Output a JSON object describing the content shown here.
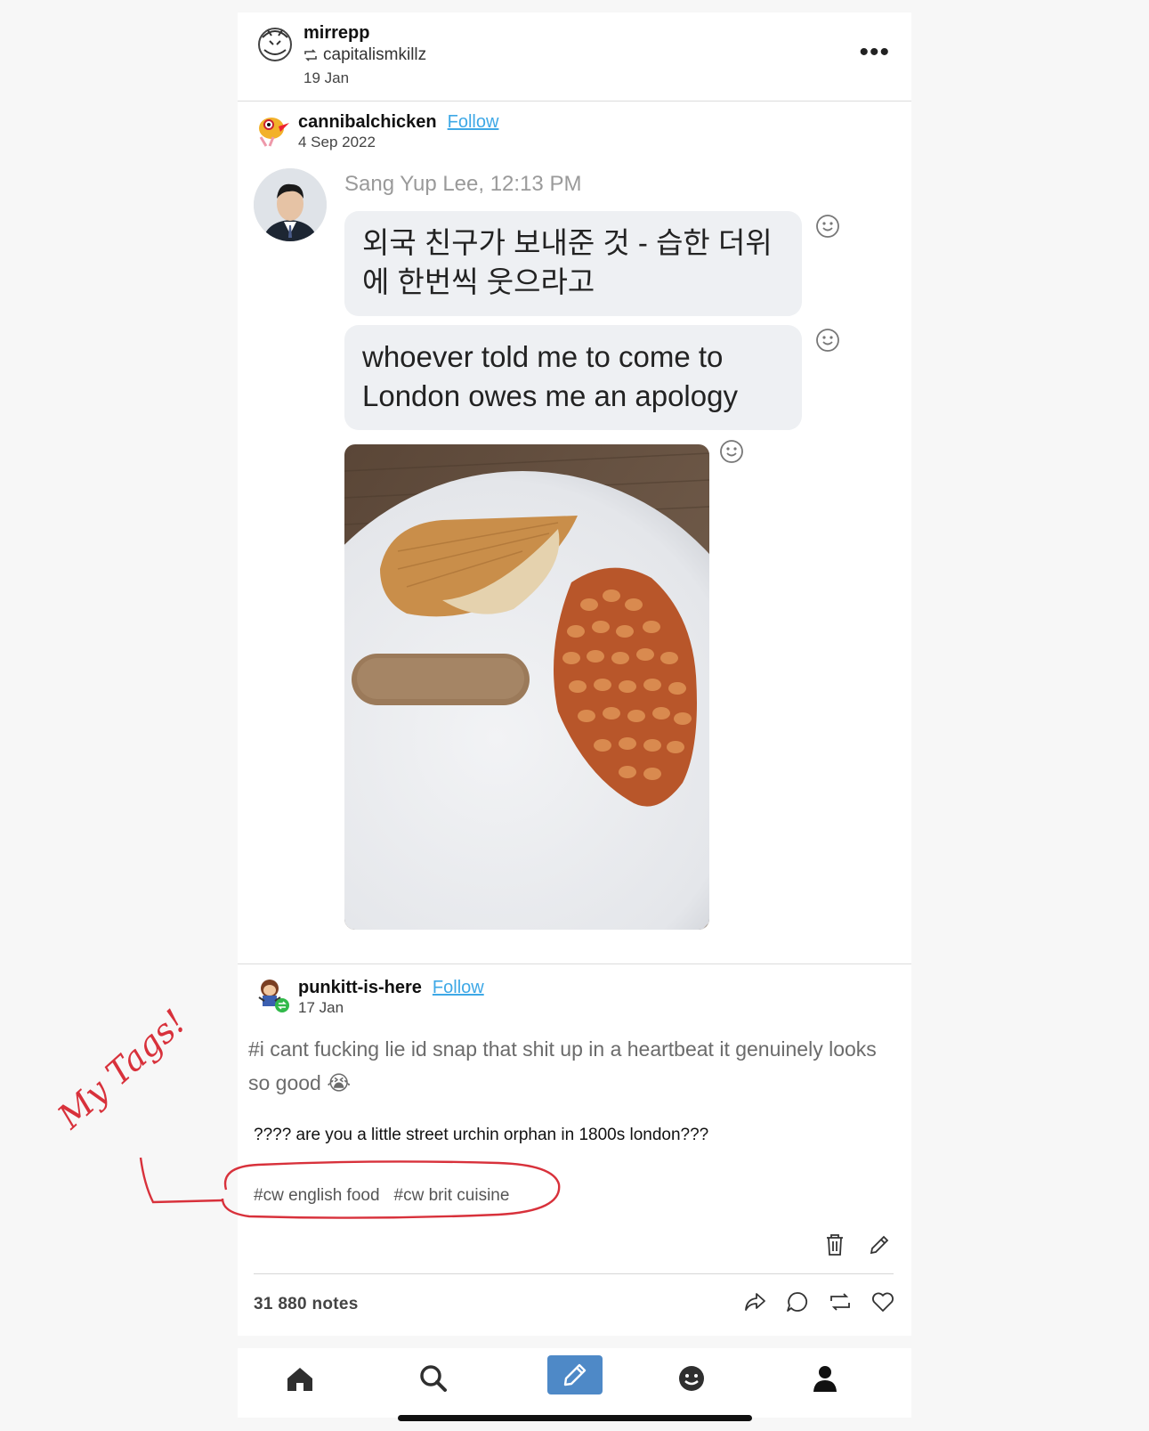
{
  "post": {
    "author": "mirrepp",
    "reblogged_from": "capitalismkillz",
    "date": "19 Jan",
    "more_label": "•••"
  },
  "source": {
    "author": "cannibalchicken",
    "follow_label": "Follow",
    "date": "4 Sep 2022"
  },
  "chat": {
    "sender": "Sang Yup Lee, 12:13 PM",
    "message_1": "외국 친구가 보내준 것 - 습한 더위에 한번씩 웃으라고",
    "message_2": "whoever told me to come to London owes me an apology"
  },
  "reblog": {
    "author": "punkitt-is-here",
    "follow_label": "Follow",
    "date": "17 Jan",
    "tagline": "#i cant fucking lie id snap that shit up in a heartbeat it genuinely looks so good 😭"
  },
  "comment": "???? are you a little street urchin orphan in 1800s london???",
  "tags": [
    "#cw english food",
    "#cw brit cuisine"
  ],
  "notes": "31 880 notes",
  "annotation": "My Tags!",
  "colors": {
    "link": "#3ea8e6",
    "compose": "#4e89c7",
    "annotation": "#d8313b"
  },
  "icons": {
    "header": [
      "reblog-icon",
      "more-icon"
    ],
    "toolbar": [
      "delete-icon",
      "edit-icon"
    ],
    "actions": [
      "share-icon",
      "reply-icon",
      "reblog-icon",
      "like-icon"
    ],
    "nav": [
      "home-icon",
      "search-icon",
      "compose-icon",
      "activity-icon",
      "account-icon"
    ]
  }
}
